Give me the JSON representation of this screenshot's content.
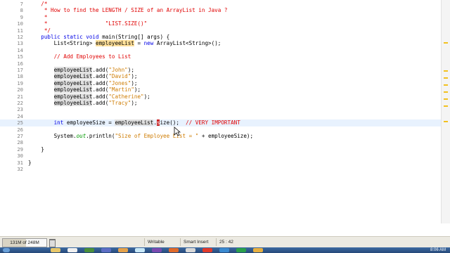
{
  "editor": {
    "lines": [
      {
        "num": "7",
        "tokens": [
          {
            "t": "    /*",
            "c": "cmr"
          }
        ]
      },
      {
        "num": "8",
        "tokens": [
          {
            "t": "     * How to find the LENGTH / SIZE of an ArrayList in Java ?",
            "c": "cmr"
          }
        ]
      },
      {
        "num": "9",
        "tokens": [
          {
            "t": "     *",
            "c": "cmr"
          }
        ]
      },
      {
        "num": "10",
        "tokens": [
          {
            "t": "     *                  \"LIST.SIZE()\"",
            "c": "cmr"
          }
        ]
      },
      {
        "num": "11",
        "tokens": [
          {
            "t": "     */",
            "c": "cmr"
          }
        ]
      },
      {
        "num": "12",
        "tokens": [
          {
            "t": "    public static void ",
            "c": "kw"
          },
          {
            "t": "main(String[] args) {",
            "c": "plain"
          }
        ]
      },
      {
        "num": "13",
        "tokens": [
          {
            "t": "        List<String> ",
            "c": "plain"
          },
          {
            "t": "employeeList",
            "c": "plain",
            "h": "occ"
          },
          {
            "t": " = ",
            "c": "plain"
          },
          {
            "t": "new ",
            "c": "kw"
          },
          {
            "t": "ArrayList<String>();",
            "c": "plain"
          }
        ]
      },
      {
        "num": "14",
        "tokens": []
      },
      {
        "num": "15",
        "tokens": [
          {
            "t": "        // Add Employees to List",
            "c": "cmr"
          }
        ]
      },
      {
        "num": "16",
        "tokens": []
      },
      {
        "num": "17",
        "tokens": [
          {
            "t": "        ",
            "c": "plain"
          },
          {
            "t": "employeeList",
            "c": "plain",
            "h": "var"
          },
          {
            "t": ".add(",
            "c": "plain"
          },
          {
            "t": "\"John\"",
            "c": "str"
          },
          {
            "t": ");",
            "c": "plain"
          }
        ]
      },
      {
        "num": "18",
        "tokens": [
          {
            "t": "        ",
            "c": "plain"
          },
          {
            "t": "employeeList",
            "c": "plain",
            "h": "var"
          },
          {
            "t": ".add(",
            "c": "plain"
          },
          {
            "t": "\"David\"",
            "c": "str"
          },
          {
            "t": ");",
            "c": "plain"
          }
        ]
      },
      {
        "num": "19",
        "tokens": [
          {
            "t": "        ",
            "c": "plain"
          },
          {
            "t": "employeeList",
            "c": "plain",
            "h": "var"
          },
          {
            "t": ".add(",
            "c": "plain"
          },
          {
            "t": "\"Jones\"",
            "c": "str"
          },
          {
            "t": ");",
            "c": "plain"
          }
        ]
      },
      {
        "num": "20",
        "tokens": [
          {
            "t": "        ",
            "c": "plain"
          },
          {
            "t": "employeeList",
            "c": "plain",
            "h": "var"
          },
          {
            "t": ".add(",
            "c": "plain"
          },
          {
            "t": "\"Martin\"",
            "c": "str"
          },
          {
            "t": ");",
            "c": "plain"
          }
        ]
      },
      {
        "num": "21",
        "tokens": [
          {
            "t": "        ",
            "c": "plain"
          },
          {
            "t": "employeeList",
            "c": "plain",
            "h": "var"
          },
          {
            "t": ".add(",
            "c": "plain"
          },
          {
            "t": "\"Catherine\"",
            "c": "str"
          },
          {
            "t": ");",
            "c": "plain"
          }
        ]
      },
      {
        "num": "22",
        "tokens": [
          {
            "t": "        ",
            "c": "plain"
          },
          {
            "t": "employeeList",
            "c": "plain",
            "h": "var"
          },
          {
            "t": ".add(",
            "c": "plain"
          },
          {
            "t": "\"Tracy\"",
            "c": "str"
          },
          {
            "t": ");",
            "c": "plain"
          }
        ]
      },
      {
        "num": "23",
        "tokens": []
      },
      {
        "num": "24",
        "tokens": []
      },
      {
        "num": "25",
        "current": true,
        "tokens": [
          {
            "t": "        int ",
            "c": "kw"
          },
          {
            "t": "employeeSize = ",
            "c": "plain"
          },
          {
            "t": "employeeList",
            "c": "plain",
            "h": "var"
          },
          {
            "t": ".",
            "c": "plain"
          },
          {
            "t": "s",
            "c": "plain",
            "h": "caret"
          },
          {
            "t": "ize();  ",
            "c": "plain"
          },
          {
            "t": "// VERY IMPORTANT",
            "c": "cmr"
          }
        ]
      },
      {
        "num": "26",
        "tokens": []
      },
      {
        "num": "27",
        "tokens": [
          {
            "t": "        System.",
            "c": "plain"
          },
          {
            "t": "out",
            "c": "plain",
            "h": "field"
          },
          {
            "t": ".println(",
            "c": "plain"
          },
          {
            "t": "\"Size of Employee List = \"",
            "c": "str"
          },
          {
            "t": " + employeeSize);",
            "c": "plain"
          }
        ]
      },
      {
        "num": "28",
        "tokens": []
      },
      {
        "num": "29",
        "tokens": [
          {
            "t": "    }",
            "c": "plain"
          }
        ]
      },
      {
        "num": "30",
        "tokens": []
      },
      {
        "num": "31",
        "tokens": [
          {
            "t": "}",
            "c": "plain"
          }
        ]
      },
      {
        "num": "32",
        "tokens": []
      }
    ]
  },
  "status_bar": {
    "heap": "131M of 248M",
    "heap_fraction": 0.53,
    "writable": "Writable",
    "insert_mode": "Smart Insert",
    "position": "25 : 42"
  },
  "taskbar": {
    "clock": "8:06 AM"
  },
  "colors": {
    "keyword": "#0000e6",
    "string": "#ce7b00",
    "comment": "#e00000",
    "occurrence_highlight": "#ffe09a",
    "current_line": "#e8f2fe"
  }
}
